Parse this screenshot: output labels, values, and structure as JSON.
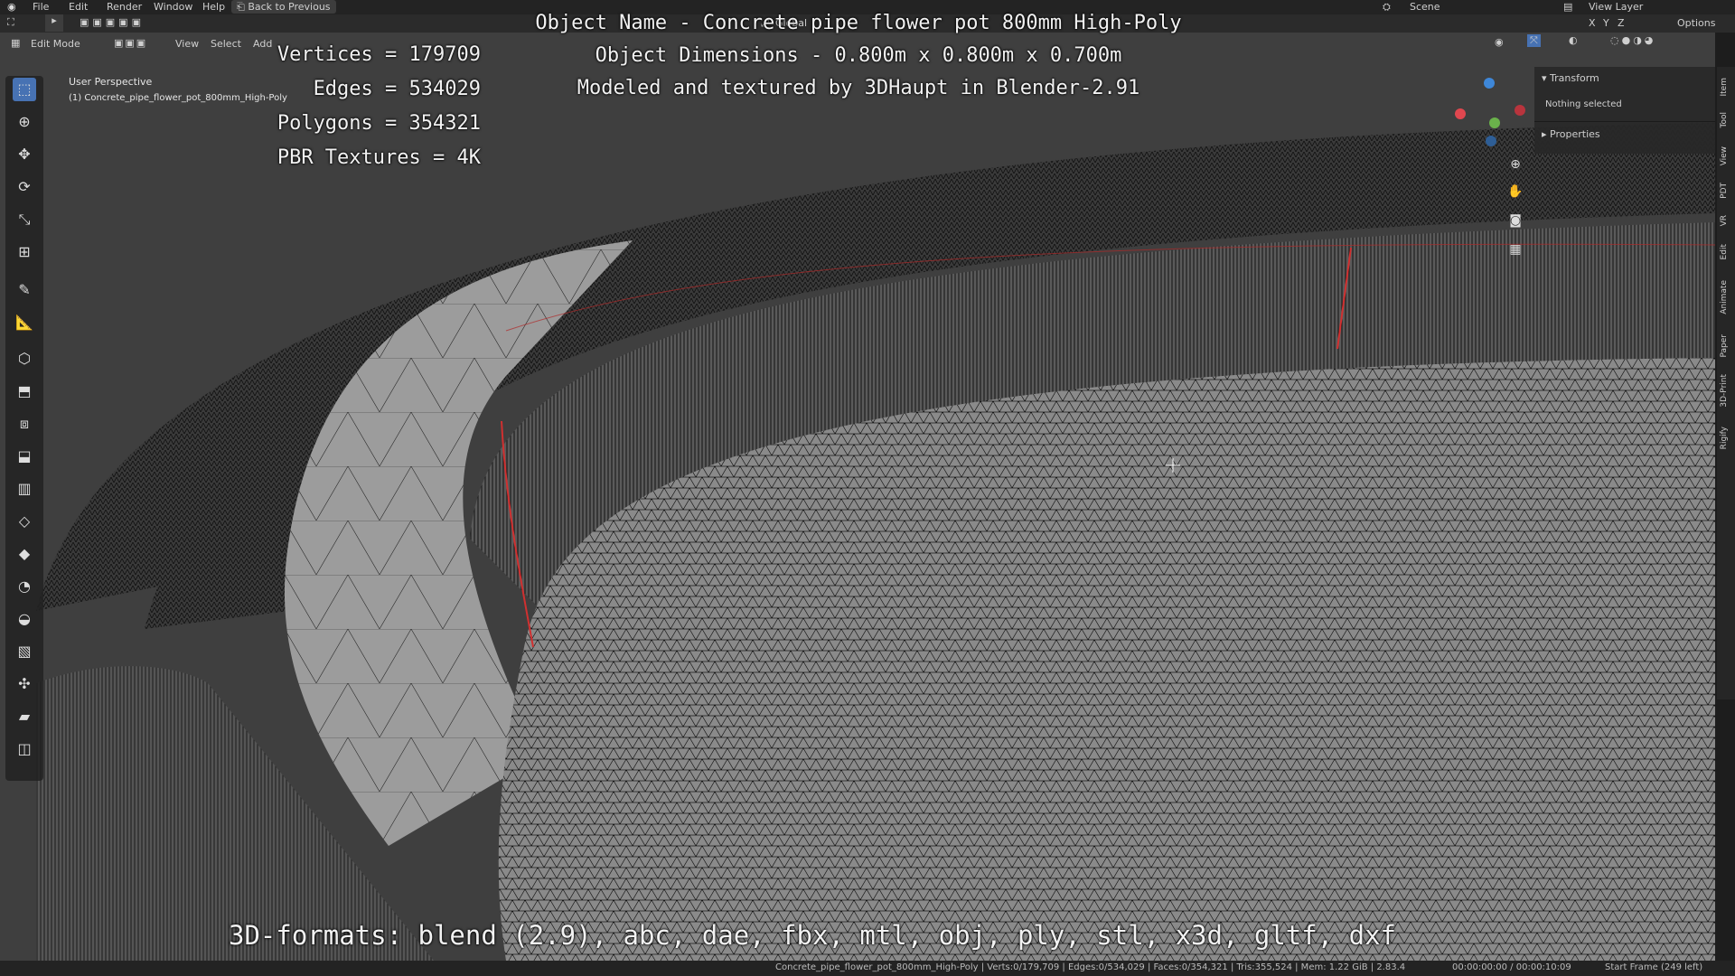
{
  "menu": {
    "items": [
      "File",
      "Edit",
      "Render",
      "Window",
      "Help"
    ],
    "back_button": "Back to Previous",
    "scene": "Scene",
    "view_layer": "View Layer"
  },
  "header": {
    "mode": "Edit Mode",
    "menus": [
      "View",
      "Select",
      "Add"
    ],
    "orientation": "Global",
    "axes": [
      "X",
      "Y",
      "Z"
    ],
    "options": "Options"
  },
  "viewport": {
    "perspective": "User Perspective",
    "object_label": "(1) Concrete_pipe_flower_pot_800mm_High-Poly"
  },
  "overlay": {
    "stats": [
      "Vertices = 179709",
      "Edges = 534029",
      "Polygons = 354321",
      "PBR Textures = 4K"
    ],
    "title_lines": [
      "Object Name - Concrete pipe flower pot 800mm High-Poly",
      "Object Dimensions -  0.800m x 0.800m x 0.700m",
      "Modeled and textured by 3DHaupt in Blender-2.91"
    ],
    "formats": "3D-formats: blend (2.9), abc, dae, fbx, mtl, obj, ply, stl, x3d, gltf, dxf"
  },
  "side_panel": {
    "transform": "Transform",
    "nothing_selected": "Nothing selected",
    "properties": "Properties",
    "tabs": [
      "Item",
      "Tool",
      "View",
      "PDT",
      "VR",
      "Edit",
      "Animate",
      "Paper",
      "3D-Print",
      "Rigify"
    ]
  },
  "statusbar": {
    "info": "Concrete_pipe_flower_pot_800mm_High-Poly | Verts:0/179,709 | Edges:0/534,029 | Faces:0/354,321 | Tris:355,524 | Mem: 1.22 GiB | 2.83.4",
    "timecode": "00:00:00:00 / 00:00:10:09",
    "frame": "Start Frame (249 left)"
  },
  "colors": {
    "accent": "#4772b3",
    "x_axis": "#e0474f",
    "y_axis": "#6ab24b",
    "z_axis": "#3e87d8",
    "seam": "#d03030"
  },
  "icons": {
    "tools": [
      "select-box-icon",
      "cursor-icon",
      "move-icon",
      "rotate-icon",
      "scale-icon",
      "transform-icon",
      "annotate-icon",
      "measure-icon",
      "add-cube-icon",
      "extrude-icon",
      "inset-icon",
      "bevel-icon",
      "loop-cut-icon",
      "knife-icon",
      "poly-build-icon",
      "spin-icon",
      "smooth-icon",
      "edge-slide-icon",
      "shrink-fatten-icon",
      "shear-icon",
      "rip-icon"
    ]
  }
}
